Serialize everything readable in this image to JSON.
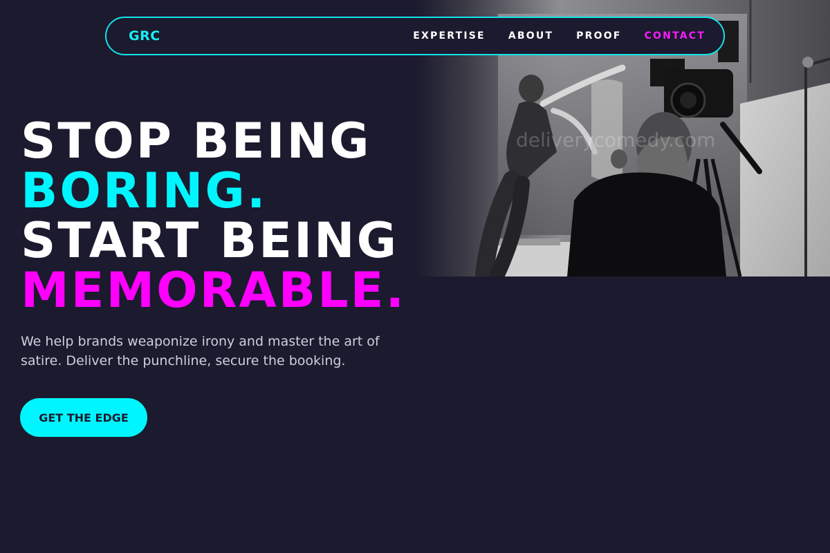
{
  "nav": {
    "logo": "GRC",
    "links": [
      {
        "label": "EXPERTISE"
      },
      {
        "label": "ABOUT"
      },
      {
        "label": "PROOF"
      },
      {
        "label": "CONTACT"
      }
    ]
  },
  "hero": {
    "line1": "STOP BEING",
    "line2": "BORING.",
    "line3": "START BEING",
    "line4": "MEMORABLE.",
    "lede": "We help brands weaponize irony and master the art of satire. Deliver the punchline, secure the booking.",
    "cta_label": "GET THE EDGE"
  },
  "photo": {
    "watermark": "deliverycomedy.com"
  },
  "colors": {
    "background": "#1b1a2e",
    "accent_cyan": "#00f6ff",
    "accent_magenta": "#ff00ff",
    "nav_border": "#14e3ea"
  }
}
